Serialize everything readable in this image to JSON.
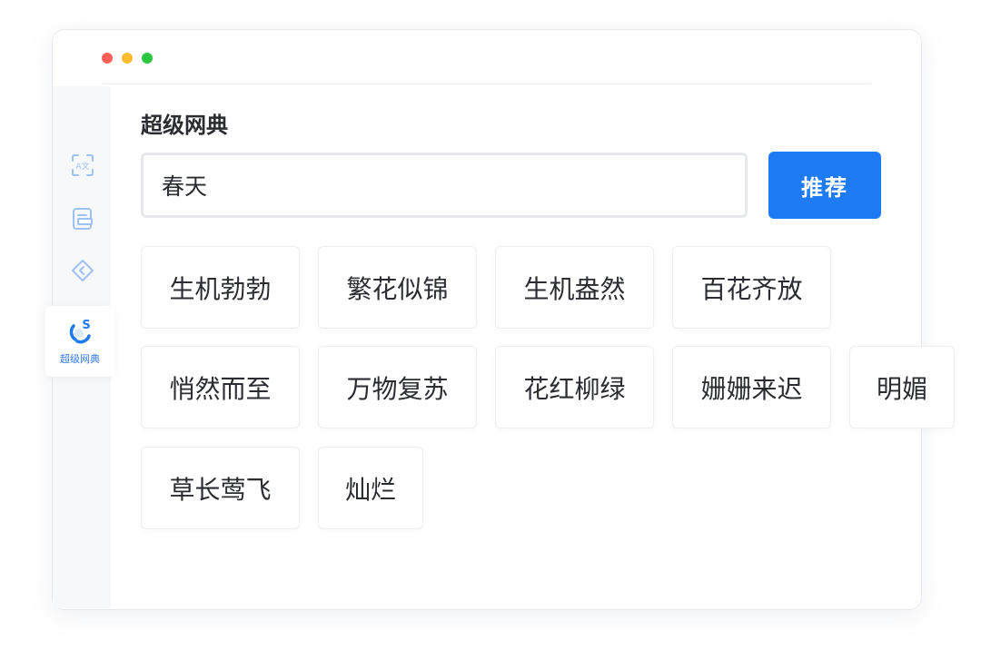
{
  "window": {
    "dots": [
      "#ff5f57",
      "#febc2e",
      "#28c840"
    ]
  },
  "sidebar": {
    "items": [
      {
        "icon": "text-scan-icon"
      },
      {
        "icon": "document-icon"
      },
      {
        "icon": "tag-icon"
      },
      {
        "icon": "dictionary-icon",
        "label": "超级网典",
        "active": true
      }
    ]
  },
  "main": {
    "title": "超级网典",
    "search": {
      "value": "春天",
      "placeholder": ""
    },
    "recommend_label": "推荐",
    "results": [
      "生机勃勃",
      "繁花似锦",
      "生机盎然",
      "百花齐放",
      "悄然而至",
      "万物复苏",
      "花红柳绿",
      "姗姗来迟",
      "明媚",
      "草长莺飞",
      "灿烂"
    ]
  },
  "colors": {
    "accent": "#1f7bf4",
    "text": "#2a2c31",
    "icon_inactive": "#9fc2f4"
  }
}
